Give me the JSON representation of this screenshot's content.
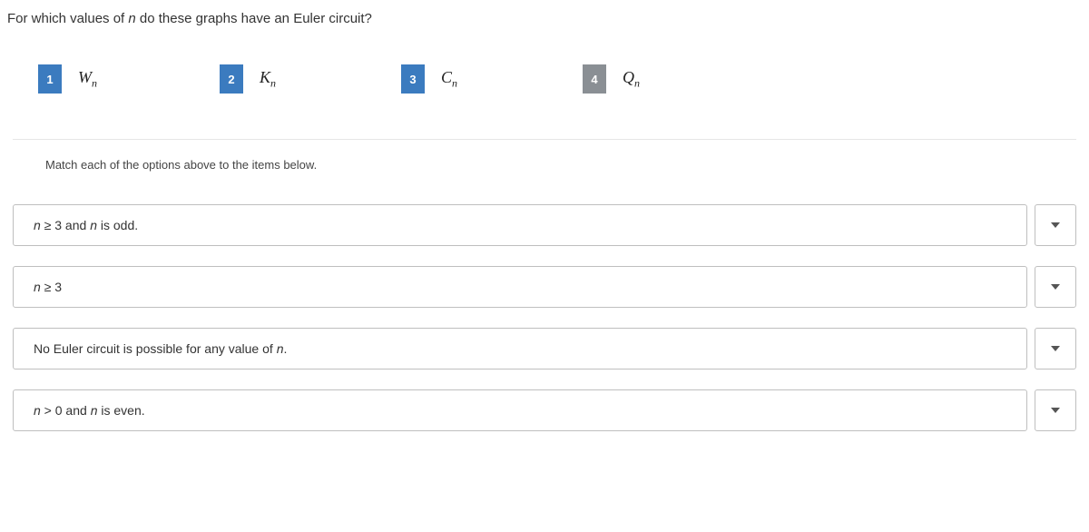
{
  "question": {
    "prefix": "For which values of ",
    "var": "n",
    "suffix": " do these graphs have an Euler circuit?"
  },
  "options": [
    {
      "num": "1",
      "label_main": "W",
      "label_sub": "n",
      "highlight": true
    },
    {
      "num": "2",
      "label_main": "K",
      "label_sub": "n",
      "highlight": true
    },
    {
      "num": "3",
      "label_main": "C",
      "label_sub": "n",
      "highlight": true
    },
    {
      "num": "4",
      "label_main": "Q",
      "label_sub": "n",
      "highlight": false
    }
  ],
  "instruction": "Match each of the options above to the items below.",
  "match_items": [
    {
      "parts": [
        {
          "text": "n",
          "italic": true
        },
        {
          "text": " ≥ 3 and ",
          "italic": false
        },
        {
          "text": "n",
          "italic": true
        },
        {
          "text": " is odd.",
          "italic": false
        }
      ]
    },
    {
      "parts": [
        {
          "text": "n",
          "italic": true
        },
        {
          "text": " ≥ 3",
          "italic": false
        }
      ]
    },
    {
      "parts": [
        {
          "text": "No Euler circuit is possible for any value of ",
          "italic": false
        },
        {
          "text": "n",
          "italic": true
        },
        {
          "text": ".",
          "italic": false
        }
      ]
    },
    {
      "parts": [
        {
          "text": "n",
          "italic": true
        },
        {
          "text": " > 0 and ",
          "italic": false
        },
        {
          "text": "n",
          "italic": true
        },
        {
          "text": " is even.",
          "italic": false
        }
      ]
    }
  ]
}
